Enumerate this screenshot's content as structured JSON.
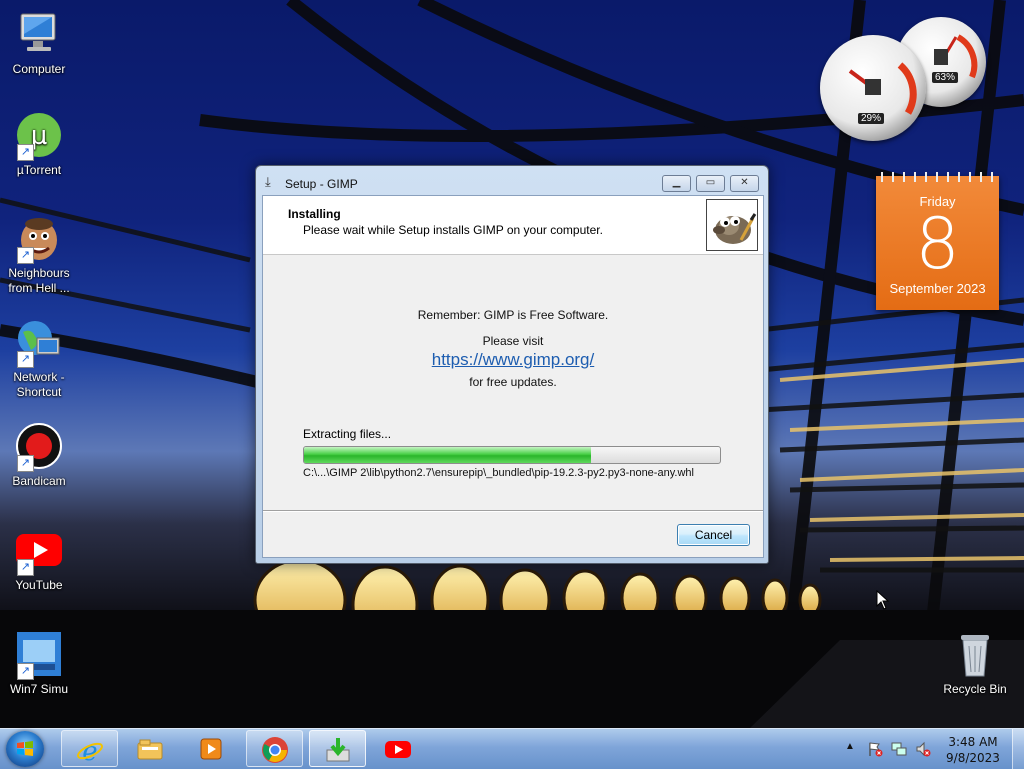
{
  "desktop": {
    "icons": [
      {
        "label": "Computer"
      },
      {
        "label": "µTorrent"
      },
      {
        "label": "Neighbours from Hell ..."
      },
      {
        "label": "Network - Shortcut"
      },
      {
        "label": "Bandicam"
      },
      {
        "label": "YouTube"
      },
      {
        "label": "Win7 Simu"
      },
      {
        "label": "Recycle Bin"
      }
    ]
  },
  "gadgets": {
    "cpu_meter": {
      "cpu_percent": "29%",
      "memory_percent": "63%"
    },
    "calendar": {
      "weekday": "Friday",
      "day": "8",
      "month_year": "September 2023"
    }
  },
  "installer": {
    "title": "Setup - GIMP",
    "header_title": "Installing",
    "header_subtitle": "Please wait while Setup installs GIMP on your computer.",
    "remember": "Remember: GIMP is Free Software.",
    "please_visit": "Please visit",
    "url": "https://www.gimp.org/",
    "for_updates": "for free updates.",
    "status": "Extracting files...",
    "progress_fraction": 0.69,
    "current_file": "C:\\...\\GIMP 2\\lib\\python2.7\\ensurepip\\_bundled\\pip-19.2.3-py2.py3-none-any.whl",
    "cancel_label": "Cancel"
  },
  "taskbar": {
    "pinned": [
      "start-button",
      "internet-explorer-icon",
      "file-explorer-icon",
      "media-player-icon",
      "chrome-icon",
      "installer-icon",
      "youtube-icon"
    ],
    "clock_time": "3:48 AM",
    "clock_date": "9/8/2023"
  },
  "colors": {
    "calendar_orange": "#e46c14",
    "progress_green": "#2bb52b",
    "link_blue": "#1d5db0"
  }
}
